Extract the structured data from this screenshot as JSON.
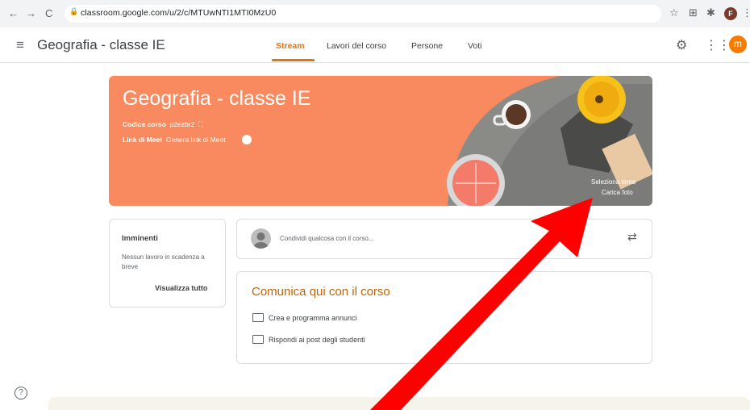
{
  "browser": {
    "url": "classroom.google.com/u/2/c/MTUwNTI1MTI0MzU0",
    "back_icon": "←",
    "forward_icon": "→",
    "reload_icon": "C",
    "profile_initial": "F"
  },
  "header": {
    "title": "Geografia - classe IE",
    "tabs": [
      "Stream",
      "Lavori del corso",
      "Persone",
      "Voti"
    ],
    "active_tab": "Stream",
    "avatar_initial": "m",
    "accent_color": "#e8710a"
  },
  "banner": {
    "title": "Geografia - classe IE",
    "course_code_label": "Codice corso",
    "course_code": "p2ezbr2",
    "meet_label": "Link di Meet",
    "meet_action": "Genera link di Meet",
    "select_theme": "Seleziona tema",
    "upload_photo": "Carica foto",
    "color": "#f98a5f"
  },
  "upcoming": {
    "title": "Imminenti",
    "text": "Nessun lavoro in scadenza a breve",
    "view_all": "Visualizza tutto"
  },
  "share": {
    "placeholder": "Condividi qualcosa con il corso..."
  },
  "communicate": {
    "title": "Comunica qui con il corso",
    "items": [
      "Crea e programma annunci",
      "Rispondi ai post degli studenti"
    ]
  },
  "annotation": {
    "arrow_color": "#ff0000"
  }
}
